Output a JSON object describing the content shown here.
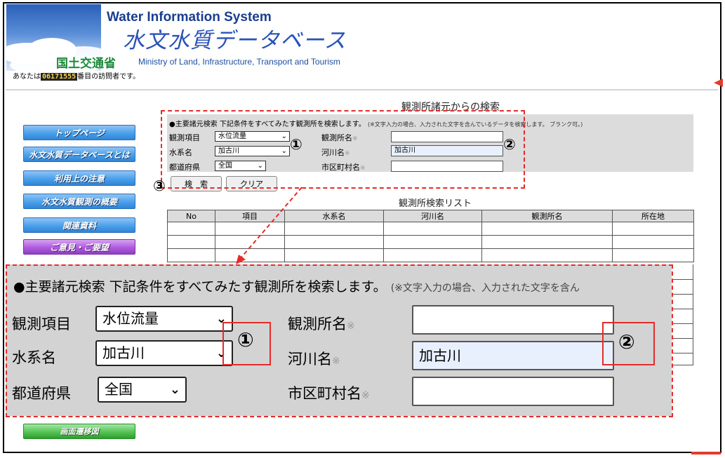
{
  "header": {
    "title_en": "Water Information System",
    "title_jp": "水文水質データベース",
    "ministry_jp": "国土交通省",
    "ministry_en": "Ministry of Land, Infrastructure, Transport and Tourism",
    "visitor_prefix": "あなたは",
    "visitor_count": "06171555",
    "visitor_suffix": "番目の訪問者です。"
  },
  "page_title": "観測所諸元からの検索",
  "sidebar": {
    "items": [
      {
        "label": "トップページ",
        "color": "blue"
      },
      {
        "label": "水文水質データベースとは",
        "color": "blue"
      },
      {
        "label": "利用上の注意",
        "color": "blue"
      },
      {
        "label": "水文水質観測の概要",
        "color": "blue"
      },
      {
        "label": "関連資料",
        "color": "blue"
      },
      {
        "label": "ご意見・ご要望",
        "color": "purple"
      },
      {
        "label": "画面遷移図",
        "color": "green"
      }
    ]
  },
  "search_form": {
    "condition_text": "●主要諸元検索 下記条件をすべてみたす観測所を検索します。",
    "condition_note": "(※文字入力の場合、入力された文字を含んでいるデータを検索します。 ブランク可。)",
    "zoom_condition_note": "(※文字入力の場合、入力された文字を含ん",
    "fields": {
      "item_label": "観測項目",
      "item_value": "水位流量",
      "system_label": "水系名",
      "system_value": "加古川",
      "prefecture_label": "都道府県",
      "prefecture_value": "全国",
      "station_label": "観測所名",
      "station_value": "",
      "river_label": "河川名",
      "river_value": "加古川",
      "city_label": "市区町村名",
      "city_value": "",
      "asterisk": "※"
    },
    "search_button": "検　索",
    "clear_button": "クリア"
  },
  "results": {
    "title": "観測所検索リスト",
    "columns": [
      "No",
      "項目",
      "水系名",
      "河川名",
      "観測所名",
      "所在地"
    ],
    "rows": []
  },
  "annotations": {
    "circle_1": "①",
    "circle_2": "②",
    "circle_3": "③",
    "highlight_color": "#e52b2b"
  },
  "colors": {
    "nav_blue": "#4aa0ea",
    "nav_purple": "#ae5bdd",
    "nav_green": "#55c455",
    "panel_gray": "#dcdcdc"
  }
}
